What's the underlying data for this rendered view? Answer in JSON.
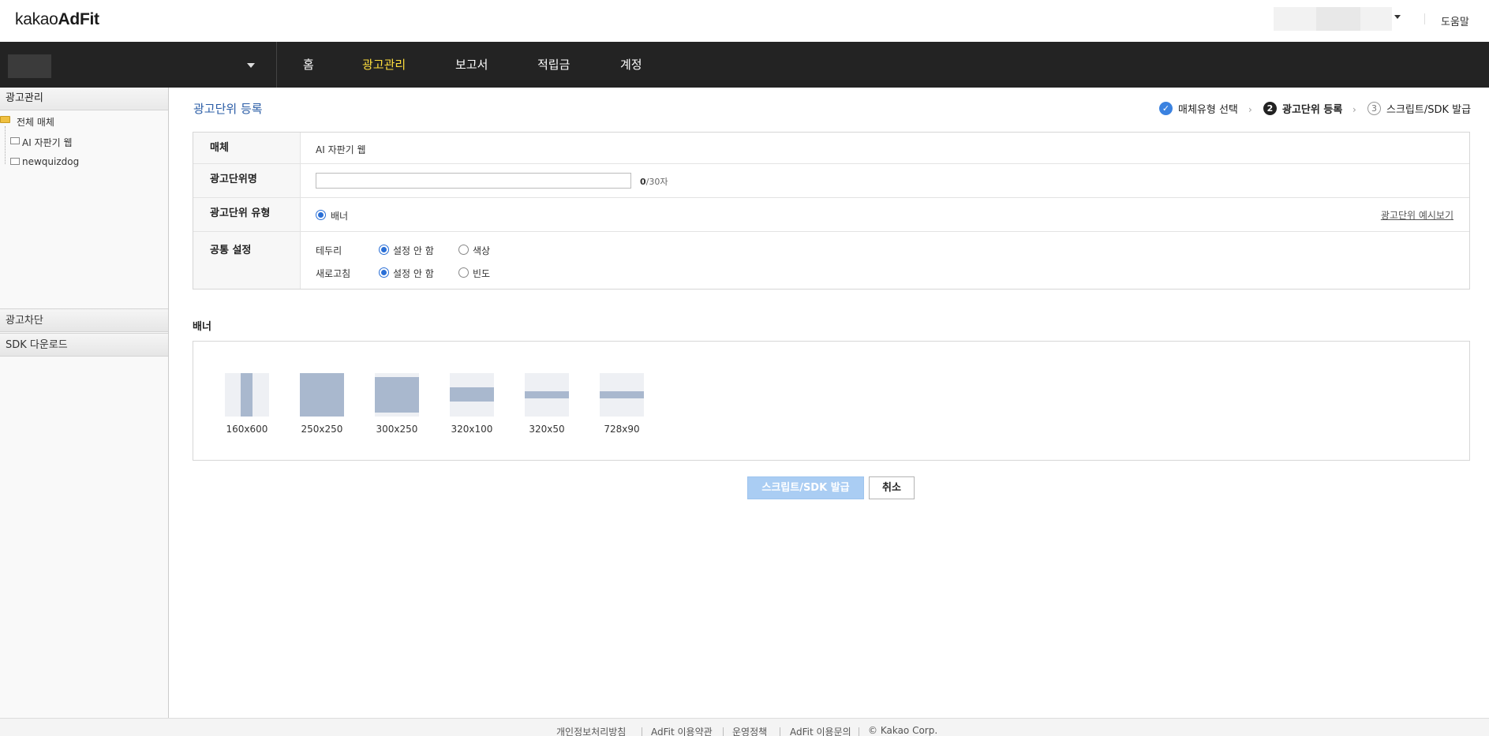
{
  "app": {
    "logo_prefix": "kakao",
    "logo_bold": "AdFit",
    "help": "도움말"
  },
  "nav": {
    "items": [
      "홈",
      "광고관리",
      "보고서",
      "적립금",
      "계정"
    ],
    "active": "광고관리"
  },
  "sidebar": {
    "header": "광고관리",
    "tree": {
      "root": "전체 매체",
      "children": [
        "AI 자판기 웹",
        "newquizdog"
      ]
    },
    "sections": [
      "광고차단",
      "SDK 다운로드"
    ]
  },
  "page": {
    "title": "광고단위 등록",
    "steps": [
      {
        "icon": "✓",
        "label": "매체유형 선택",
        "state": "done"
      },
      {
        "icon": "2",
        "label": "광고단위 등록",
        "state": "current"
      },
      {
        "icon": "3",
        "label": "스크립트/SDK 발급",
        "state": "pending"
      }
    ]
  },
  "form": {
    "media": {
      "label": "매체",
      "value": "AI 자판기 웹"
    },
    "unit_name": {
      "label": "광고단위명",
      "value": "",
      "placeholder": "",
      "counter_current": "0",
      "counter_max": "/30자"
    },
    "unit_type": {
      "label": "광고단위 유형",
      "option": "배너",
      "example_link": "광고단위 예시보기"
    },
    "common": {
      "label": "공통 설정",
      "border": {
        "label": "테두리",
        "options": [
          "설정 안 함",
          "색상"
        ],
        "selected": "설정 안 함"
      },
      "refresh": {
        "label": "새로고침",
        "options": [
          "설정 안 함",
          "빈도"
        ],
        "selected": "설정 안 함"
      }
    }
  },
  "banner": {
    "title": "배너",
    "sizes": [
      "160x600",
      "250x250",
      "300x250",
      "320x100",
      "320x50",
      "728x90"
    ]
  },
  "buttons": {
    "issue": "스크립트/SDK 발급",
    "cancel": "취소"
  },
  "footer": {
    "links": [
      "개인정보처리방침",
      "AdFit 이용약관",
      "운영정책",
      "AdFit 이용문의",
      "© Kakao Corp."
    ]
  },
  "colors": {
    "nav_bg": "#232323",
    "nav_active": "#ffdf3d",
    "accent": "#2a6fd6",
    "title": "#2a5ca6",
    "issue_button": "#aacdf3"
  }
}
